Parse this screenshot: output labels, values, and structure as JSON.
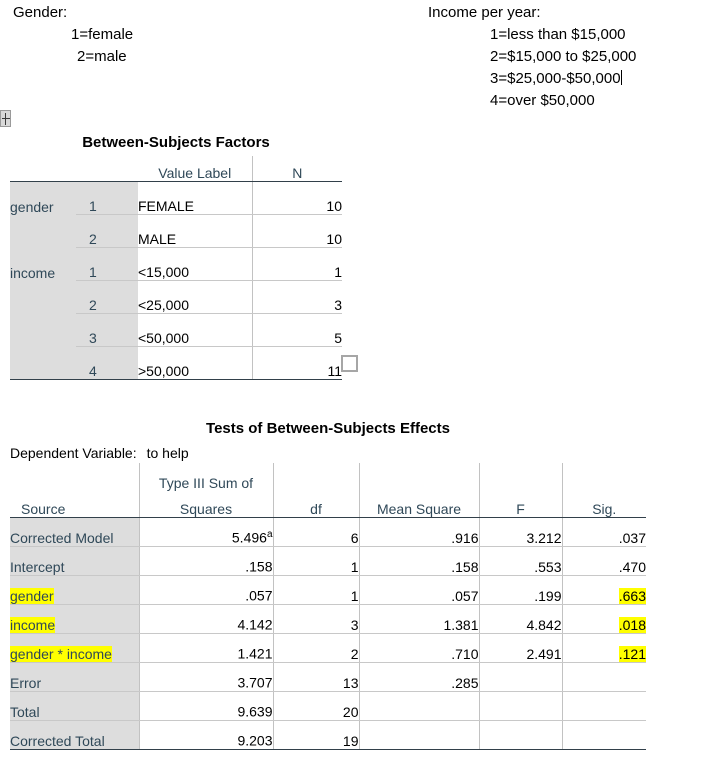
{
  "notes": {
    "left": {
      "heading": "Gender:",
      "items": [
        "1=female",
        "2=male"
      ]
    },
    "right": {
      "heading": "Income per year:",
      "items": [
        "1=less than $15,000",
        "2=$15,000 to $25,000",
        "3=$25,000-$50,000",
        "4=over $50,000"
      ],
      "caret_after_item_index": 2
    }
  },
  "factors_table": {
    "title": "Between-Subjects Factors",
    "headers": {
      "variable": "",
      "value": "",
      "value_label": "Value Label",
      "n": "N"
    },
    "rows": [
      {
        "variable": "gender",
        "value": "1",
        "value_label": "FEMALE",
        "n": "10"
      },
      {
        "variable": "",
        "value": "2",
        "value_label": "MALE",
        "n": "10"
      },
      {
        "variable": "income",
        "value": "1",
        "value_label": "<15,000",
        "n": "1"
      },
      {
        "variable": "",
        "value": "2",
        "value_label": "<25,000",
        "n": "3"
      },
      {
        "variable": "",
        "value": "3",
        "value_label": "<50,000",
        "n": "5"
      },
      {
        "variable": "",
        "value": "4",
        "value_label": ">50,000",
        "n": "11"
      }
    ]
  },
  "effects_table": {
    "title": "Tests of Between-Subjects Effects",
    "dependent_variable_label": "Dependent Variable:",
    "dependent_variable_name": "to help",
    "headers": {
      "source": "Source",
      "ss_line1": "Type III Sum of",
      "ss_line2": "Squares",
      "df": "df",
      "mean_square": "Mean Square",
      "f": "F",
      "sig": "Sig."
    },
    "rows": [
      {
        "source": "Corrected Model",
        "ss": "5.496",
        "ss_sup": "a",
        "df": "6",
        "ms": ".916",
        "f": "3.212",
        "sig": ".037",
        "source_highlight": false,
        "sig_highlight": false
      },
      {
        "source": "Intercept",
        "ss": ".158",
        "ss_sup": "",
        "df": "1",
        "ms": ".158",
        "f": ".553",
        "sig": ".470",
        "source_highlight": false,
        "sig_highlight": false
      },
      {
        "source": "gender",
        "ss": ".057",
        "ss_sup": "",
        "df": "1",
        "ms": ".057",
        "f": ".199",
        "sig": ".663",
        "source_highlight": true,
        "sig_highlight": true
      },
      {
        "source": "income",
        "ss": "4.142",
        "ss_sup": "",
        "df": "3",
        "ms": "1.381",
        "f": "4.842",
        "sig": ".018",
        "source_highlight": true,
        "sig_highlight": true
      },
      {
        "source": "gender * income",
        "ss": "1.421",
        "ss_sup": "",
        "df": "2",
        "ms": ".710",
        "f": "2.491",
        "sig": ".121",
        "source_highlight": true,
        "sig_highlight": true
      },
      {
        "source": "Error",
        "ss": "3.707",
        "ss_sup": "",
        "df": "13",
        "ms": ".285",
        "f": "",
        "sig": "",
        "source_highlight": false,
        "sig_highlight": false
      },
      {
        "source": "Total",
        "ss": "9.639",
        "ss_sup": "",
        "df": "20",
        "ms": "",
        "f": "",
        "sig": "",
        "source_highlight": false,
        "sig_highlight": false
      },
      {
        "source": "Corrected Total",
        "ss": "9.203",
        "ss_sup": "",
        "df": "19",
        "ms": "",
        "f": "",
        "sig": "",
        "source_highlight": false,
        "sig_highlight": false
      }
    ]
  },
  "colors": {
    "highlight": "#ffff00",
    "row_label_bg": "#dddddd",
    "header_text": "#2f4858",
    "rule_dark": "#32404a",
    "rule_light": "#c8c8c8"
  }
}
